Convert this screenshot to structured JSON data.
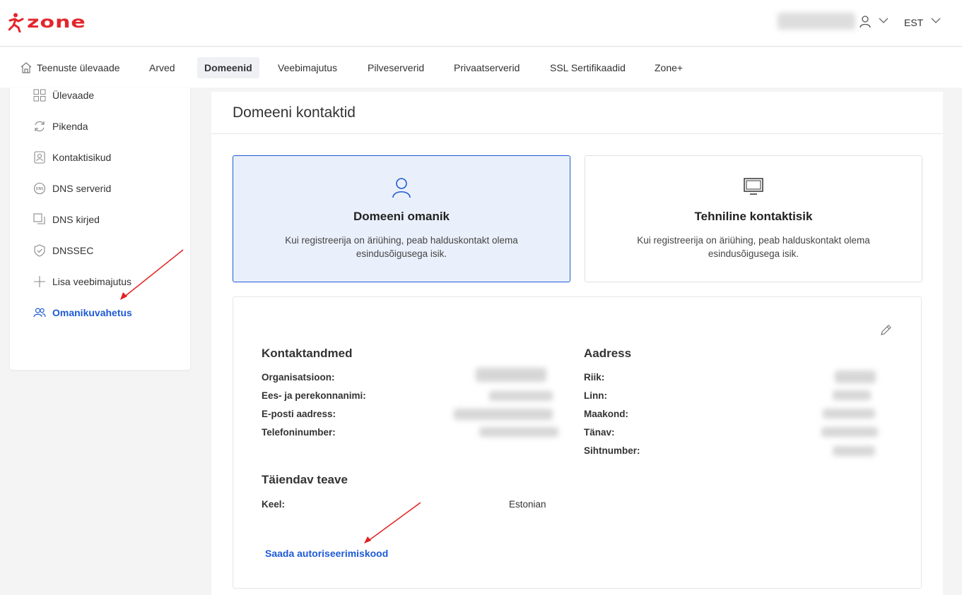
{
  "brand": {
    "logo_text": "zone",
    "accent": "#e3262d",
    "link_color": "#1e5bd6"
  },
  "header": {
    "language": "EST"
  },
  "topnav": {
    "items": [
      {
        "label": "Teenuste ülevaade",
        "icon": "home-icon"
      },
      {
        "label": "Arved"
      },
      {
        "label": "Domeenid",
        "active": true
      },
      {
        "label": "Veebimajutus"
      },
      {
        "label": "Pilveserverid"
      },
      {
        "label": "Privaatserverid"
      },
      {
        "label": "SSL Sertifikaadid"
      },
      {
        "label": "Zone+"
      }
    ]
  },
  "sidebar": {
    "items": [
      {
        "label": "Ülevaade",
        "icon": "grid-icon"
      },
      {
        "label": "Pikenda",
        "icon": "refresh-icon"
      },
      {
        "label": "Kontaktisikud",
        "icon": "contact-card-icon"
      },
      {
        "label": "DNS serverid",
        "icon": "dns-icon"
      },
      {
        "label": "DNS kirjed",
        "icon": "copy-icon"
      },
      {
        "label": "DNSSEC",
        "icon": "shield-icon"
      },
      {
        "label": "Lisa veebimajutus",
        "icon": "plus-icon"
      },
      {
        "label": "Omanikuvahetus",
        "icon": "users-icon",
        "active": true
      }
    ]
  },
  "main": {
    "title": "Domeeni kontaktid",
    "choices": [
      {
        "title": "Domeeni omanik",
        "desc": "Kui registreerija on äriühing, peab halduskontakt olema esindusõigusega isik.",
        "icon": "person-icon",
        "selected": true
      },
      {
        "title": "Tehniline kontaktisik",
        "desc": "Kui registreerija on äriühing, peab halduskontakt olema esindusõigusega isik.",
        "icon": "monitor-icon",
        "selected": false
      }
    ],
    "contact": {
      "title": "Kontaktandmed",
      "labels": [
        "Organisatsioon:",
        "Ees- ja perekonnanimi:",
        "E-posti aadress:",
        "Telefoninumber:"
      ]
    },
    "address": {
      "title": "Aadress",
      "labels": [
        "Riik:",
        "Linn:",
        "Maakond:",
        "Tänav:",
        "Sihtnumber:"
      ]
    },
    "extra": {
      "title": "Täiendav teave",
      "language_label": "Keel:",
      "language_value": "Estonian"
    },
    "send_auth_code": "Saada autoriseerimiskood"
  }
}
